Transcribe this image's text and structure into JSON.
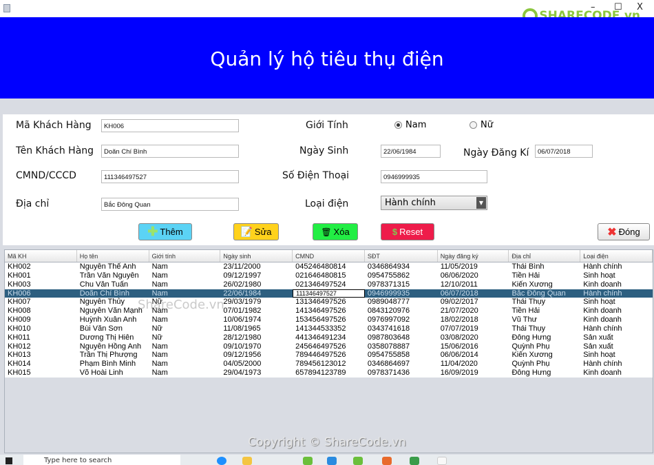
{
  "window": {
    "title": "",
    "watermark_logo": "SHARECODE.vn",
    "minimize": "–",
    "maximize": "☐",
    "close": "X"
  },
  "header": {
    "title": "Quản lý hộ tiêu thụ điện"
  },
  "form": {
    "ma_kh": {
      "label": "Mã Khách Hàng",
      "value": "KH006"
    },
    "ten_kh": {
      "label": "Tên Khách Hàng",
      "value": "Doãn Chí Bình"
    },
    "cmnd": {
      "label": "CMND/CCCD",
      "value": "111346497527"
    },
    "dia_chi": {
      "label": "Địa chỉ",
      "value": "Bắc Đông Quan"
    },
    "gioi_tinh": {
      "label": "Giới Tính",
      "options": [
        "Nam",
        "Nữ"
      ],
      "selected": "Nam"
    },
    "ngay_sinh": {
      "label": "Ngày Sinh",
      "value": "22/06/1984"
    },
    "ngay_dang_ki": {
      "label": "Ngày Đăng Kí",
      "value": "06/07/2018"
    },
    "sdt": {
      "label": "Số Điện Thoại",
      "value": "0946999935"
    },
    "loai_dien": {
      "label": "Loại điện",
      "value": "Hành chính"
    }
  },
  "buttons": {
    "them": "Thêm",
    "sua": "Sửa",
    "xoa": "Xóa",
    "reset": "Reset",
    "dong": "Đóng"
  },
  "colors": {
    "header": "#0000ff",
    "them": "#5bd3f5",
    "sua": "#ffd21c",
    "xoa": "#22ee44",
    "reset": "#ee1c4a",
    "selected_row": "#2d5f80"
  },
  "table": {
    "columns": [
      "Mã KH",
      "Họ tên",
      "Giới tính",
      "Ngày sinh",
      "CMND",
      "SĐT",
      "Ngày đăng ký",
      "Địa chỉ",
      "Loại điện"
    ],
    "selected_index": 3,
    "rows": [
      [
        "KH002",
        "Nguyễn Thế Anh",
        "Nam",
        "23/11/2000",
        "045246480814",
        "0346864934",
        "11/05/2019",
        "Thái Bình",
        "Hành chính"
      ],
      [
        "KH001",
        "Trần Văn Nguyên",
        "Nam",
        "09/12/1997",
        "021646480815",
        "0954755862",
        "06/06/2020",
        "Tiền Hải",
        "Sinh hoạt"
      ],
      [
        "KH003",
        "Chu Văn Tuấn",
        "Nam",
        "26/02/1980",
        "021346497524",
        "0978371315",
        "12/10/2011",
        "Kiến Xương",
        "Kinh doanh"
      ],
      [
        "KH006",
        "Doãn Chí Bình",
        "Nam",
        "22/06/1984",
        "111346497527",
        "0946999935",
        "06/07/2018",
        "Bắc Đông Quan",
        "Hành chính"
      ],
      [
        "KH007",
        "Nguyễn Thủy",
        "Nữ",
        "29/03/1979",
        "131346497526",
        "0989048777",
        "09/02/2017",
        "Thái Thụy",
        "Sinh hoạt"
      ],
      [
        "KH008",
        "Nguyễn Văn Mạnh",
        "Nam",
        "07/01/1982",
        "141346497526",
        "0843120976",
        "21/07/2020",
        "Tiền Hải",
        "Kinh doanh"
      ],
      [
        "KH009",
        "Huỳnh Xuân Anh",
        "Nam",
        "10/06/1974",
        "153456497526",
        "0976997092",
        "18/02/2018",
        "Vũ Thư",
        "Kinh doanh"
      ],
      [
        "KH010",
        "Bùi Văn Sơn",
        "Nữ",
        "11/08/1965",
        "141344533352",
        "0343741618",
        "07/07/2019",
        "Thái Thụy",
        "Hành chính"
      ],
      [
        "KH011",
        "Dương Thị Hiên",
        "Nữ",
        "28/12/1980",
        "441346491234",
        "0987803648",
        "03/08/2020",
        "Đông Hưng",
        "Sản xuất"
      ],
      [
        "KH012",
        "Nguyễn Hồng Anh",
        "Nam",
        "09/10/1970",
        "245646497526",
        "0358078887",
        "15/06/2016",
        "Quỳnh Phụ",
        "Sản xuất"
      ],
      [
        "KH013",
        "Trần Thị Phượng",
        "Nam",
        "09/12/1956",
        "789446497526",
        "0954755858",
        "06/06/2014",
        "Kiến Xương",
        "Sinh hoạt"
      ],
      [
        "KH014",
        "Phạm Bình Minh",
        "Nam",
        "04/05/2000",
        "789456123012",
        "0346864697",
        "11/04/2020",
        "Quỳnh Phụ",
        "Hành chính"
      ],
      [
        "KH015",
        "Võ Hoài Linh",
        "Nam",
        "29/04/1973",
        "657894123789",
        "0978371436",
        "16/09/2019",
        "Đông Hưng",
        "Kinh doanh"
      ]
    ]
  },
  "watermarks": {
    "center": "ShareCode.vn",
    "footer": "Copyright © ShareCode.vn"
  },
  "taskbar": {
    "search_placeholder": "Type here to search"
  }
}
